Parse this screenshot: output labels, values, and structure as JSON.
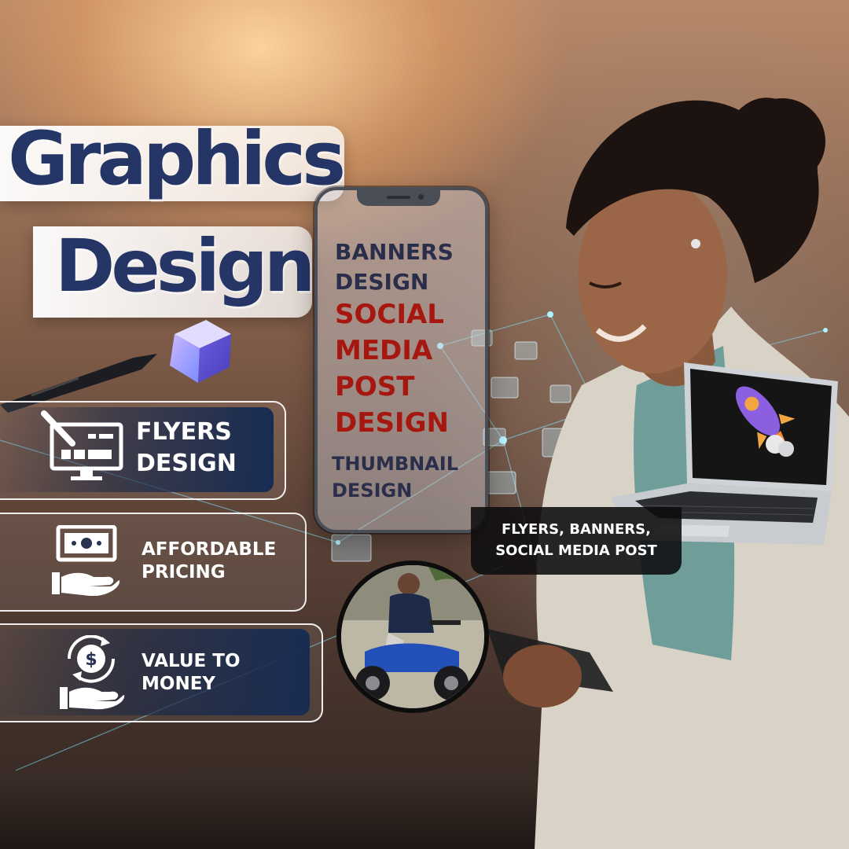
{
  "title": {
    "line1": "Graphics",
    "line2": "Design"
  },
  "features": [
    {
      "icon": "design-monitor-icon",
      "label_line1": "FLYERS",
      "label_line2": "DESIGN"
    },
    {
      "icon": "money-hand-icon",
      "label_line1": "AFFORDABLE",
      "label_line2": "PRICING"
    },
    {
      "icon": "dollar-cycle-hand-icon",
      "label_line1": "VALUE TO",
      "label_line2": "MONEY"
    }
  ],
  "phone_lines": [
    {
      "text": "BANNERS",
      "color": "#2a2e4a"
    },
    {
      "text": "DESIGN",
      "color": "#2a2e4a"
    },
    {
      "text": "SOCIAL",
      "color": "#a5170f"
    },
    {
      "text": "MEDIA",
      "color": "#a5170f"
    },
    {
      "text": "POST",
      "color": "#a5170f"
    },
    {
      "text": "DESIGN",
      "color": "#a5170f"
    },
    {
      "text": "THUMBNAIL",
      "color": "#2a2e4a"
    },
    {
      "text": "DESIGN",
      "color": "#2a2e4a"
    }
  ],
  "laptop_tag": {
    "line1": "FLYERS, BANNERS,",
    "line2": "SOCIAL MEDIA POST"
  },
  "colors": {
    "title": "#253566",
    "card_dark": "#182c52",
    "accent_red": "#a5170f"
  }
}
